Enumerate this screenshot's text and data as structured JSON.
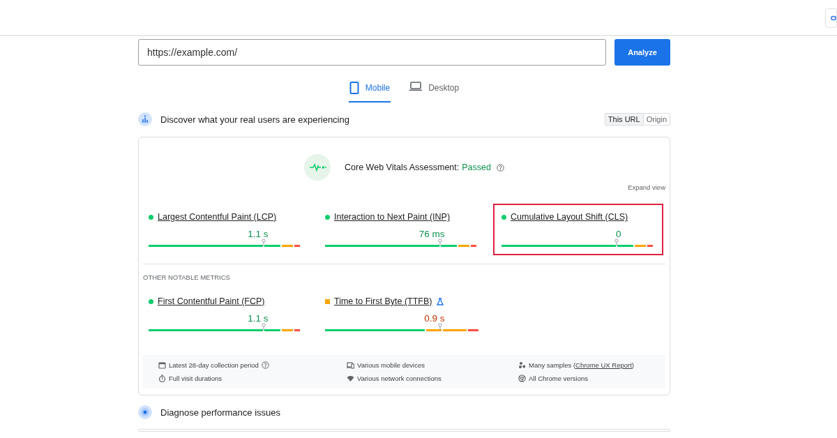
{
  "url_field": {
    "value": "https://example.com/"
  },
  "analyze_button": {
    "label": "Analyze"
  },
  "tabs": [
    {
      "label": "Mobile",
      "kind": "mobile",
      "selected": true
    },
    {
      "label": "Desktop",
      "kind": "desktop",
      "selected": false
    }
  ],
  "field_section": {
    "title": "Discover what your real users are experiencing",
    "toggle": [
      {
        "label": "This URL",
        "selected": true
      },
      {
        "label": "Origin",
        "selected": false
      }
    ]
  },
  "assessment": {
    "label": "Core Web Vitals Assessment:",
    "result": "Passed",
    "expand": "Expand view"
  },
  "core_metrics": [
    {
      "name": "Largest Contentful Paint (LCP)",
      "value": "1.1 s",
      "kind": "good",
      "color": "#0cce6b",
      "level": 0.75,
      "highlighted": false
    },
    {
      "name": "Interaction to Next Paint (INP)",
      "value": "76 ms",
      "kind": "good",
      "color": "#0cce6b",
      "level": 0.75,
      "highlighted": false
    },
    {
      "name": "Cumulative Layout Shift (CLS)",
      "value": "0",
      "kind": "good",
      "color": "#0cce6b",
      "level": 0.75,
      "highlighted": true
    }
  ],
  "other_heading": "OTHER NOTABLE METRICS",
  "other_metrics": [
    {
      "name": "First Contentful Paint (FCP)",
      "value": "1.1 s",
      "kind": "good",
      "color": "#0cce6b",
      "level": 0.75,
      "experimental": false
    },
    {
      "name": "Time to First Byte (TTFB)",
      "value": "0.9 s",
      "kind": "average",
      "color": "#ffa400",
      "level": 0.75,
      "experimental": true
    }
  ],
  "footer_notes": [
    {
      "kind": "calendar",
      "text": "Latest 28-day collection period",
      "help": true
    },
    {
      "kind": "devices",
      "text": "Various mobile devices",
      "help": false
    },
    {
      "kind": "samples",
      "text": "Many samples (",
      "link": "Chrome UX Report",
      "after": ")",
      "help": false
    },
    {
      "kind": "timer",
      "text": "Full visit durations",
      "help": false
    },
    {
      "kind": "wifi",
      "text": "Various network connections",
      "help": false
    },
    {
      "kind": "chrome",
      "text": "All Chrome versions",
      "help": false
    }
  ],
  "diagnose_section": {
    "title": "Diagnose performance issues"
  }
}
